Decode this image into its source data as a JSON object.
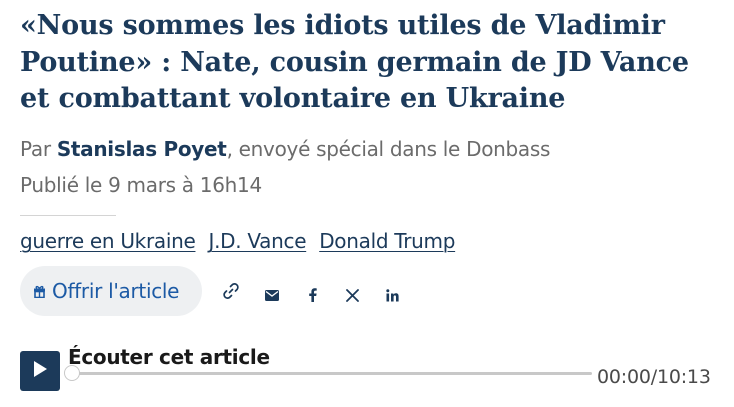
{
  "article": {
    "headline": "«Nous sommes les idiots utiles de Vladimir Poutine» : Nate, cousin germain de JD Vance et combattant volontaire en Ukraine",
    "byline_prefix": "Par",
    "author": "Stanislas Poyet",
    "byline_suffix": ", envoyé spécial dans le Donbass",
    "published": "Publié le 9 mars à 16h14"
  },
  "tags": [
    {
      "label": "guerre en Ukraine"
    },
    {
      "label": "J.D. Vance"
    },
    {
      "label": "Donald Trump"
    }
  ],
  "share": {
    "offer_label": "Offrir l'article",
    "icons": [
      "gift-icon",
      "link-icon",
      "mail-icon",
      "facebook-icon",
      "x-icon",
      "linkedin-icon"
    ]
  },
  "audio": {
    "title": "Écouter cet article",
    "time": "00:00/10:13",
    "progress": 0
  },
  "colors": {
    "headline": "#1c3a5a",
    "link_blue": "#1c5aa5",
    "meta_gray": "#6b6b6b",
    "button_bg": "#eef0f2"
  }
}
